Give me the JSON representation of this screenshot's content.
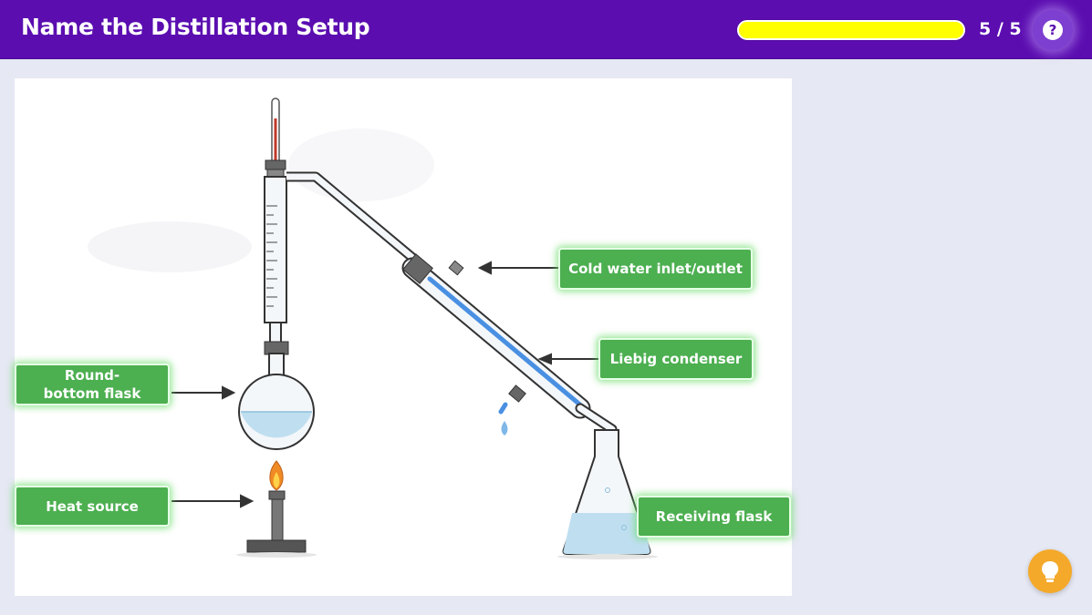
{
  "header": {
    "title": "Name the Distillation Setup",
    "progress_fraction": 1.0,
    "counter": "5 / 5",
    "help_symbol": "?"
  },
  "labels": {
    "cold_water": "Cold water inlet/outlet",
    "liebig": "Liebig condenser",
    "round_bottom": "Round-bottom flask",
    "heat_source": "Heat source",
    "receiving": "Receiving flask"
  },
  "icons": {
    "help": "question-circle-icon",
    "hint": "lightbulb-icon"
  },
  "colors": {
    "header_bg": "#5b0db0",
    "progress": "#ffff00",
    "label_bg": "#4caf50",
    "hint_bg": "#f4a92a"
  }
}
